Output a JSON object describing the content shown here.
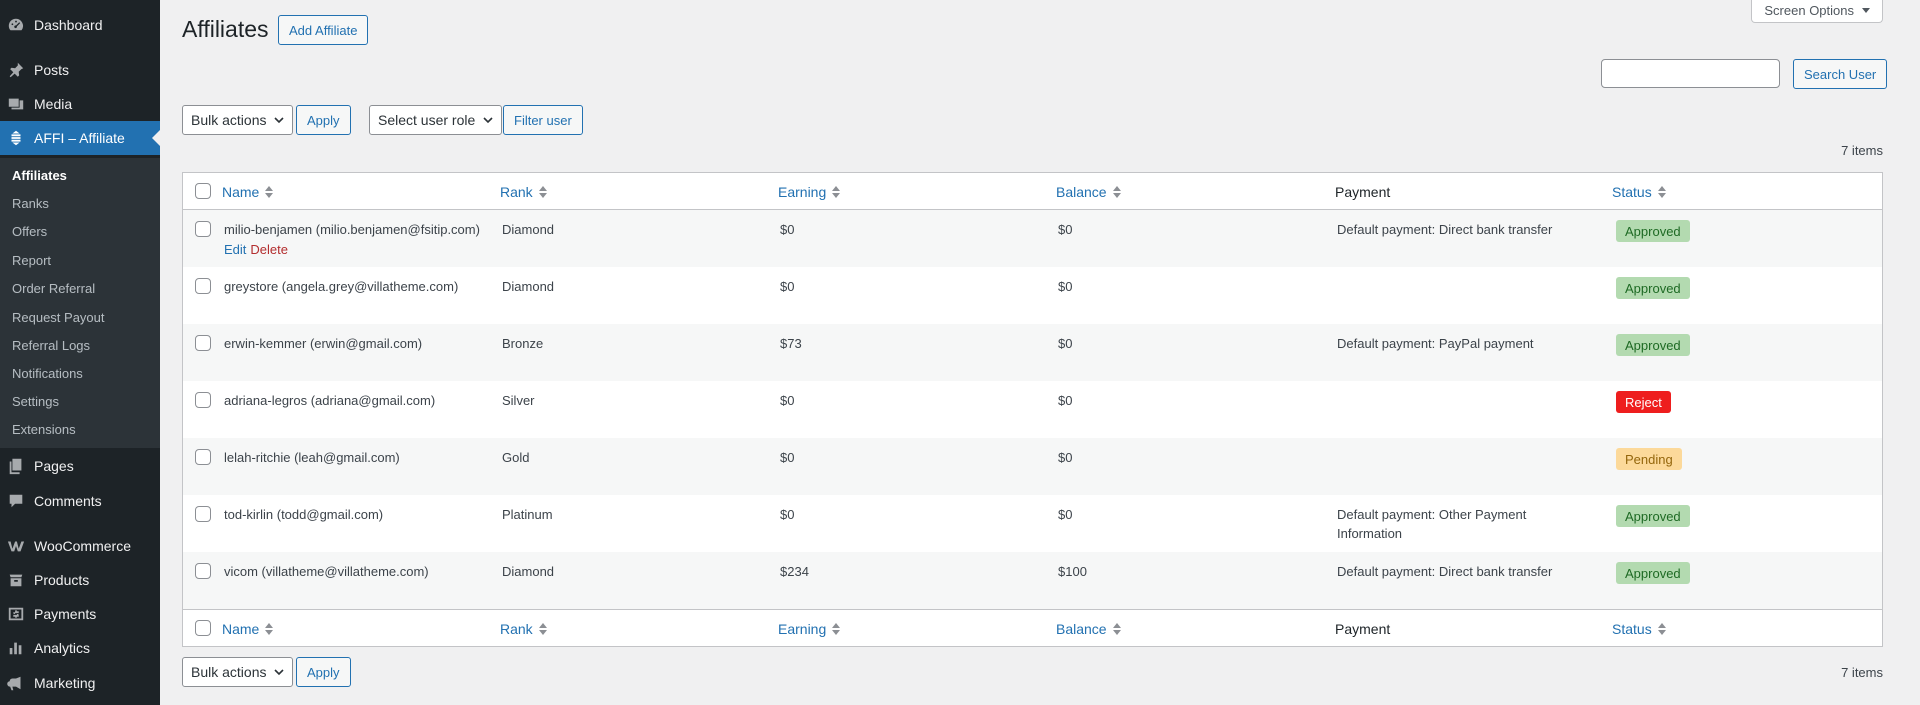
{
  "sidebar": {
    "items": [
      {
        "label": "Dashboard",
        "icon": "dashboard-icon"
      },
      {
        "label": "Posts",
        "icon": "pin-icon"
      },
      {
        "label": "Media",
        "icon": "media-icon"
      },
      {
        "label": "AFFI – Affiliate",
        "icon": "affiliate-icon"
      },
      {
        "label": "Pages",
        "icon": "pages-icon"
      },
      {
        "label": "Comments",
        "icon": "comment-icon"
      },
      {
        "label": "WooCommerce",
        "icon": "woocommerce-icon"
      },
      {
        "label": "Products",
        "icon": "products-icon"
      },
      {
        "label": "Payments",
        "icon": "payments-icon"
      },
      {
        "label": "Analytics",
        "icon": "analytics-icon"
      },
      {
        "label": "Marketing",
        "icon": "megaphone-icon"
      }
    ],
    "submenu": [
      "Affiliates",
      "Ranks",
      "Offers",
      "Report",
      "Order Referral",
      "Request Payout",
      "Referral Logs",
      "Notifications",
      "Settings",
      "Extensions"
    ]
  },
  "header": {
    "title": "Affiliates",
    "add_button": "Add Affiliate",
    "screen_options": "Screen Options",
    "search_button": "Search User",
    "search_value": ""
  },
  "filters": {
    "bulk_actions": "Bulk actions",
    "apply": "Apply",
    "user_role": "Select user role",
    "filter_button": "Filter user",
    "items_count": "7 items"
  },
  "table": {
    "columns": [
      "Name",
      "Rank",
      "Earning",
      "Balance",
      "Payment",
      "Status"
    ],
    "row_actions": {
      "edit": "Edit",
      "delete": "Delete"
    },
    "rows": [
      {
        "name": "milio-benjamen (milio.benjamen@fsitip.com)",
        "rank": "Diamond",
        "earning": "$0",
        "balance": "$0",
        "payment": "Default payment: Direct bank transfer",
        "status": "Approved"
      },
      {
        "name": "greystore (angela.grey@villatheme.com)",
        "rank": "Diamond",
        "earning": "$0",
        "balance": "$0",
        "payment": "",
        "status": "Approved"
      },
      {
        "name": "erwin-kemmer (erwin@gmail.com)",
        "rank": "Bronze",
        "earning": "$73",
        "balance": "$0",
        "payment": "Default payment: PayPal payment",
        "status": "Approved"
      },
      {
        "name": "adriana-legros (adriana@gmail.com)",
        "rank": "Silver",
        "earning": "$0",
        "balance": "$0",
        "payment": "",
        "status": "Reject"
      },
      {
        "name": "lelah-ritchie (leah@gmail.com)",
        "rank": "Gold",
        "earning": "$0",
        "balance": "$0",
        "payment": "",
        "status": "Pending"
      },
      {
        "name": "tod-kirlin (todd@gmail.com)",
        "rank": "Platinum",
        "earning": "$0",
        "balance": "$0",
        "payment": "Default payment: Other Payment Information",
        "status": "Approved"
      },
      {
        "name": "vicom (villatheme@villatheme.com)",
        "rank": "Diamond",
        "earning": "$234",
        "balance": "$100",
        "payment": "Default payment: Direct bank transfer",
        "status": "Approved"
      }
    ]
  },
  "colors": {
    "sidebar_bg": "#1d2327",
    "submenu_bg": "#2c3338",
    "accent": "#2271b1",
    "approved_bg": "#b3dab0",
    "reject_bg": "#ee1e1e",
    "pending_bg": "#fcd99a"
  }
}
